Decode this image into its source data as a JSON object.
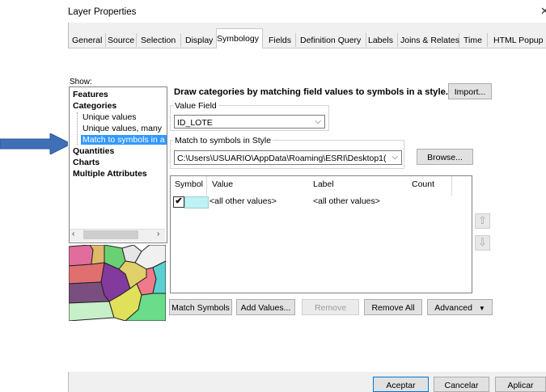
{
  "window": {
    "title": "Layer Properties",
    "close": "✕"
  },
  "tabs": [
    "General",
    "Source",
    "Selection",
    "Display",
    "Symbology",
    "Fields",
    "Definition Query",
    "Labels",
    "Joins & Relates",
    "Time",
    "HTML Popup"
  ],
  "active_tab": "Symbology",
  "show": {
    "label": "Show:",
    "items": [
      "Features",
      "Categories",
      "Unique values",
      "Unique values, many",
      "Match to symbols in a",
      "Quantities",
      "Charts",
      "Multiple Attributes"
    ],
    "selected": "Match to symbols in a"
  },
  "symbology": {
    "description": "Draw categories by matching field values to symbols in a style.",
    "import_label": "Import...",
    "value_field_label": "Value Field",
    "value_field": "ID_LOTE",
    "style_label": "Match to symbols in Style",
    "style_path": "C:\\Users\\USUARIO\\AppData\\Roaming\\ESRI\\Desktop1(",
    "browse_label": "Browse..."
  },
  "table": {
    "headers": [
      "Symbol",
      "Value",
      "Label",
      "Count"
    ],
    "rows": [
      {
        "checked": "✔",
        "value": "<all other values>",
        "label": "<all other values>",
        "count": "",
        "color": "#bff2f5"
      }
    ]
  },
  "actions": {
    "match_symbols": "Match Symbols",
    "add_values": "Add Values...",
    "remove": "Remove",
    "remove_all": "Remove All",
    "advanced": "Advanced"
  },
  "footer": {
    "ok": "Aceptar",
    "cancel": "Cancelar",
    "apply": "Aplicar"
  },
  "colors": {
    "annotation_arrow": "#3f6fb6",
    "selection": "#3399ff",
    "symbol_swatch": "#bff2f5"
  },
  "icons": {
    "up": "move-up-icon",
    "down": "move-down-icon",
    "scroll_left": "scroll-left-icon",
    "scroll_right": "scroll-right-icon"
  }
}
